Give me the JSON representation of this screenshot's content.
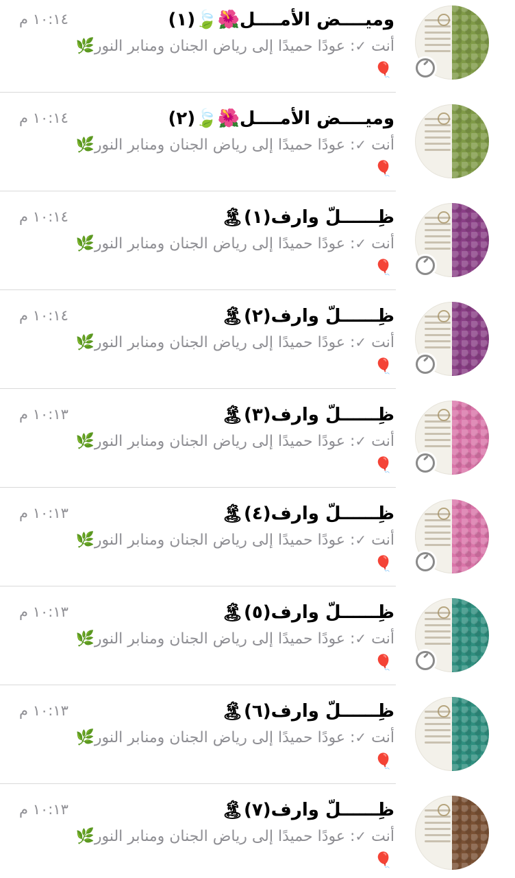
{
  "colors": {
    "green": "#7f9a47",
    "purple": "#8a3f86",
    "pink": "#d974a8",
    "teal": "#2f8f7f",
    "brown": "#7a5134"
  },
  "chats": [
    {
      "title": "وميــــض الأمــــل🌺🍃(١)",
      "time": "١٠:١٤ م",
      "sender": "أنت",
      "check": "✓",
      "message": "عودًا حميدًا إلى رياض الجنان ومنابر النور🌿",
      "extra": "🎈",
      "color_key": "green"
    },
    {
      "title": "وميــــض الأمــــل🌺🍃(٢)",
      "time": "١٠:١٤ م",
      "sender": "أنت",
      "check": "✓",
      "message": "عودًا حميدًا إلى رياض الجنان ومنابر النور🌿",
      "extra": "🎈",
      "color_key": "green"
    },
    {
      "title": "ظِــــــلّ وارف(١)🏝",
      "time": "١٠:١٤ م",
      "sender": "أنت",
      "check": "✓",
      "message": "عودًا حميدًا إلى رياض الجنان ومنابر النور🌿",
      "extra": "🎈",
      "color_key": "purple"
    },
    {
      "title": "ظِــــــلّ وارف(٢)🏝",
      "time": "١٠:١٤ م",
      "sender": "أنت",
      "check": "✓",
      "message": "عودًا حميدًا إلى رياض الجنان ومنابر النور🌿",
      "extra": "🎈",
      "color_key": "purple"
    },
    {
      "title": "ظِــــــلّ وارف(٣)🏝",
      "time": "١٠:١٣ م",
      "sender": "أنت",
      "check": "✓",
      "message": "عودًا حميدًا إلى رياض الجنان ومنابر النور🌿",
      "extra": "🎈",
      "color_key": "pink"
    },
    {
      "title": "ظِــــــلّ وارف(٤)🏝",
      "time": "١٠:١٣ م",
      "sender": "أنت",
      "check": "✓",
      "message": "عودًا حميدًا إلى رياض الجنان ومنابر النور🌿",
      "extra": "🎈",
      "color_key": "pink"
    },
    {
      "title": "ظِــــــلّ وارف(٥)🏝",
      "time": "١٠:١٣ م",
      "sender": "أنت",
      "check": "✓",
      "message": "عودًا حميدًا إلى رياض الجنان ومنابر النور🌿",
      "extra": "🎈",
      "color_key": "teal"
    },
    {
      "title": "ظِــــــلّ وارف(٦)🏝",
      "time": "١٠:١٣ م",
      "sender": "أنت",
      "check": "✓",
      "message": "عودًا حميدًا إلى رياض الجنان ومنابر النور🌿",
      "extra": "🎈",
      "color_key": "teal"
    },
    {
      "title": "ظِــــــلّ وارف(٧)🏝",
      "time": "١٠:١٣ م",
      "sender": "أنت",
      "check": "✓",
      "message": "عودًا حميدًا إلى رياض الجنان ومنابر النور🌿",
      "extra": "🎈",
      "color_key": "brown"
    }
  ]
}
